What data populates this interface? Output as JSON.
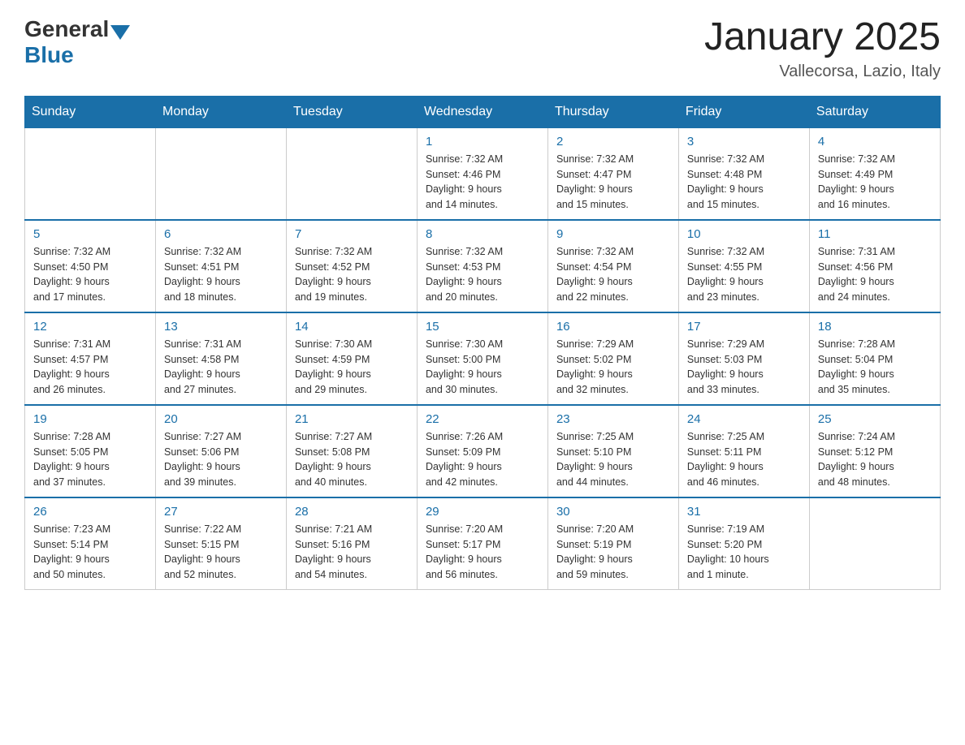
{
  "header": {
    "logo_general": "General",
    "logo_blue": "Blue",
    "title": "January 2025",
    "subtitle": "Vallecorsa, Lazio, Italy"
  },
  "days_of_week": [
    "Sunday",
    "Monday",
    "Tuesday",
    "Wednesday",
    "Thursday",
    "Friday",
    "Saturday"
  ],
  "weeks": [
    [
      {
        "day": "",
        "info": ""
      },
      {
        "day": "",
        "info": ""
      },
      {
        "day": "",
        "info": ""
      },
      {
        "day": "1",
        "info": "Sunrise: 7:32 AM\nSunset: 4:46 PM\nDaylight: 9 hours\nand 14 minutes."
      },
      {
        "day": "2",
        "info": "Sunrise: 7:32 AM\nSunset: 4:47 PM\nDaylight: 9 hours\nand 15 minutes."
      },
      {
        "day": "3",
        "info": "Sunrise: 7:32 AM\nSunset: 4:48 PM\nDaylight: 9 hours\nand 15 minutes."
      },
      {
        "day": "4",
        "info": "Sunrise: 7:32 AM\nSunset: 4:49 PM\nDaylight: 9 hours\nand 16 minutes."
      }
    ],
    [
      {
        "day": "5",
        "info": "Sunrise: 7:32 AM\nSunset: 4:50 PM\nDaylight: 9 hours\nand 17 minutes."
      },
      {
        "day": "6",
        "info": "Sunrise: 7:32 AM\nSunset: 4:51 PM\nDaylight: 9 hours\nand 18 minutes."
      },
      {
        "day": "7",
        "info": "Sunrise: 7:32 AM\nSunset: 4:52 PM\nDaylight: 9 hours\nand 19 minutes."
      },
      {
        "day": "8",
        "info": "Sunrise: 7:32 AM\nSunset: 4:53 PM\nDaylight: 9 hours\nand 20 minutes."
      },
      {
        "day": "9",
        "info": "Sunrise: 7:32 AM\nSunset: 4:54 PM\nDaylight: 9 hours\nand 22 minutes."
      },
      {
        "day": "10",
        "info": "Sunrise: 7:32 AM\nSunset: 4:55 PM\nDaylight: 9 hours\nand 23 minutes."
      },
      {
        "day": "11",
        "info": "Sunrise: 7:31 AM\nSunset: 4:56 PM\nDaylight: 9 hours\nand 24 minutes."
      }
    ],
    [
      {
        "day": "12",
        "info": "Sunrise: 7:31 AM\nSunset: 4:57 PM\nDaylight: 9 hours\nand 26 minutes."
      },
      {
        "day": "13",
        "info": "Sunrise: 7:31 AM\nSunset: 4:58 PM\nDaylight: 9 hours\nand 27 minutes."
      },
      {
        "day": "14",
        "info": "Sunrise: 7:30 AM\nSunset: 4:59 PM\nDaylight: 9 hours\nand 29 minutes."
      },
      {
        "day": "15",
        "info": "Sunrise: 7:30 AM\nSunset: 5:00 PM\nDaylight: 9 hours\nand 30 minutes."
      },
      {
        "day": "16",
        "info": "Sunrise: 7:29 AM\nSunset: 5:02 PM\nDaylight: 9 hours\nand 32 minutes."
      },
      {
        "day": "17",
        "info": "Sunrise: 7:29 AM\nSunset: 5:03 PM\nDaylight: 9 hours\nand 33 minutes."
      },
      {
        "day": "18",
        "info": "Sunrise: 7:28 AM\nSunset: 5:04 PM\nDaylight: 9 hours\nand 35 minutes."
      }
    ],
    [
      {
        "day": "19",
        "info": "Sunrise: 7:28 AM\nSunset: 5:05 PM\nDaylight: 9 hours\nand 37 minutes."
      },
      {
        "day": "20",
        "info": "Sunrise: 7:27 AM\nSunset: 5:06 PM\nDaylight: 9 hours\nand 39 minutes."
      },
      {
        "day": "21",
        "info": "Sunrise: 7:27 AM\nSunset: 5:08 PM\nDaylight: 9 hours\nand 40 minutes."
      },
      {
        "day": "22",
        "info": "Sunrise: 7:26 AM\nSunset: 5:09 PM\nDaylight: 9 hours\nand 42 minutes."
      },
      {
        "day": "23",
        "info": "Sunrise: 7:25 AM\nSunset: 5:10 PM\nDaylight: 9 hours\nand 44 minutes."
      },
      {
        "day": "24",
        "info": "Sunrise: 7:25 AM\nSunset: 5:11 PM\nDaylight: 9 hours\nand 46 minutes."
      },
      {
        "day": "25",
        "info": "Sunrise: 7:24 AM\nSunset: 5:12 PM\nDaylight: 9 hours\nand 48 minutes."
      }
    ],
    [
      {
        "day": "26",
        "info": "Sunrise: 7:23 AM\nSunset: 5:14 PM\nDaylight: 9 hours\nand 50 minutes."
      },
      {
        "day": "27",
        "info": "Sunrise: 7:22 AM\nSunset: 5:15 PM\nDaylight: 9 hours\nand 52 minutes."
      },
      {
        "day": "28",
        "info": "Sunrise: 7:21 AM\nSunset: 5:16 PM\nDaylight: 9 hours\nand 54 minutes."
      },
      {
        "day": "29",
        "info": "Sunrise: 7:20 AM\nSunset: 5:17 PM\nDaylight: 9 hours\nand 56 minutes."
      },
      {
        "day": "30",
        "info": "Sunrise: 7:20 AM\nSunset: 5:19 PM\nDaylight: 9 hours\nand 59 minutes."
      },
      {
        "day": "31",
        "info": "Sunrise: 7:19 AM\nSunset: 5:20 PM\nDaylight: 10 hours\nand 1 minute."
      },
      {
        "day": "",
        "info": ""
      }
    ]
  ]
}
